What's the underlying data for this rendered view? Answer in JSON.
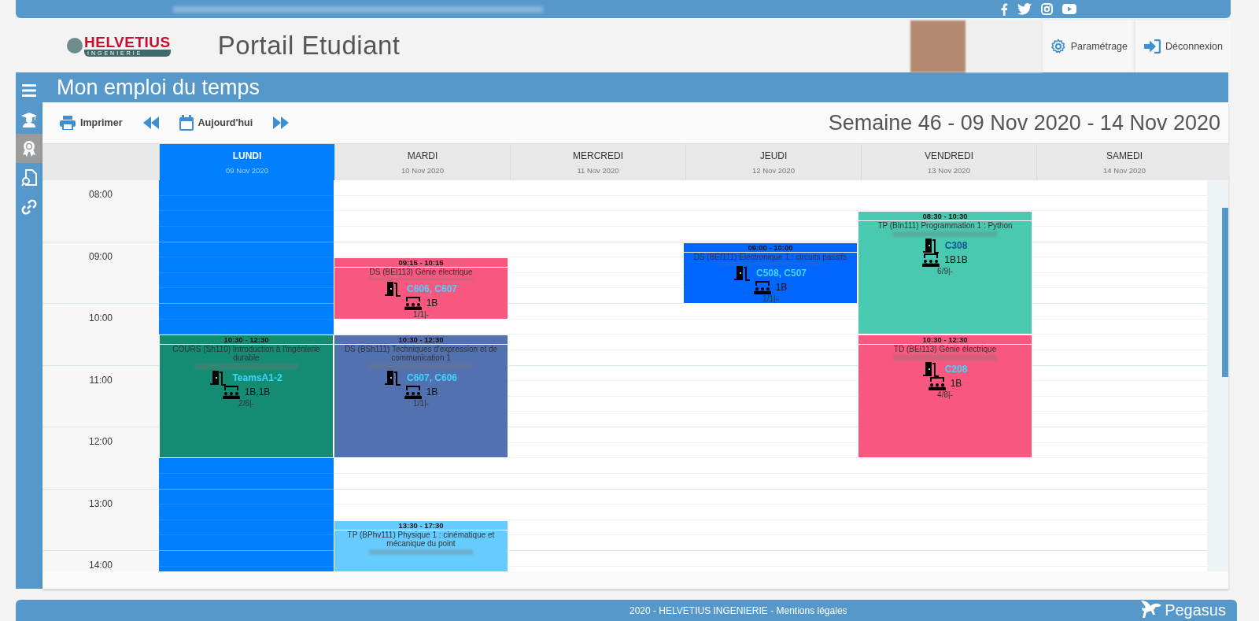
{
  "header": {
    "logo_name": "HELVETIUS",
    "logo_sub": "INGENIERIE",
    "title": "Portail Etudiant",
    "settings": "Paramétrage",
    "logout": "Déconnexion"
  },
  "sidebar": {
    "items": [
      {
        "kind": "menu",
        "selected": false
      },
      {
        "kind": "graduate",
        "selected": false
      },
      {
        "kind": "award",
        "selected": true
      },
      {
        "kind": "document",
        "selected": false
      },
      {
        "kind": "link",
        "selected": false
      }
    ]
  },
  "page_title": "Mon emploi du temps",
  "toolbar": {
    "print": "Imprimer",
    "today": "Aujourd'hui",
    "week": "Semaine 46 - 09 Nov 2020 - 14 Nov 2020"
  },
  "hours": [
    "08:00",
    "09:00",
    "10:00",
    "11:00",
    "12:00",
    "13:00",
    "14:00"
  ],
  "days": [
    {
      "label": "LUNDI",
      "date": "09 Nov 2020",
      "selected": true,
      "events": [
        {
          "time": "10:30 - 12:30",
          "title": "COURS (Sh110) Introduction à l'ingénierie durable",
          "room": "TeamsA1-2",
          "group": "1B,1B",
          "count": "2/6|-",
          "color": "#148c73"
        }
      ]
    },
    {
      "label": "MARDI",
      "date": "10 Nov 2020",
      "selected": false,
      "events": [
        {
          "time": "09:15 - 10:15",
          "title": "DS (BEI113) Génie électrique",
          "room": "C606, C607",
          "group": "1B",
          "count": "1/1|-",
          "color": "#f8587f"
        },
        {
          "time": "10:30 - 12:30",
          "title": "DS (BSh111) Techniques d'expression et de communication 1",
          "room": "C607, C606",
          "group": "1B",
          "count": "1/1|-",
          "color": "#5271b0"
        },
        {
          "time": "13:30 - 17:30",
          "title": "TP (BPhv111) Physique 1 : cinématique et mécanique du point",
          "color": "#66ccff"
        }
      ]
    },
    {
      "label": "MERCREDI",
      "date": "11 Nov 2020",
      "selected": false
    },
    {
      "label": "JEUDI",
      "date": "12 Nov 2020",
      "selected": false,
      "events": [
        {
          "time": "09:00 - 10:00",
          "title": "DS (BEI111) Electronique 1 : circuits passifs",
          "room": "C508, C507",
          "group": "1B",
          "count": "1/1|-",
          "color": "#0066ff"
        }
      ]
    },
    {
      "label": "VENDREDI",
      "date": "13 Nov 2020",
      "selected": false,
      "events": [
        {
          "time": "08:30 - 10:30",
          "title": "TP (BIn111) Programmation 1 : Python",
          "room": "C308",
          "group": "1B1B",
          "count": "6/9|-",
          "color": "#48c9b0"
        },
        {
          "time": "10:30 - 12:30",
          "title": "TD (BEI113) Génie électrique",
          "room": "C208",
          "group": "1B",
          "count": "4/8|-",
          "color": "#f8587f"
        }
      ]
    },
    {
      "label": "SAMEDI",
      "date": "14 Nov 2020",
      "selected": false
    }
  ],
  "footer": {
    "text": "2020 - HELVETIUS INGENIERIE - Mentions légales",
    "brand": "Pegasus"
  }
}
